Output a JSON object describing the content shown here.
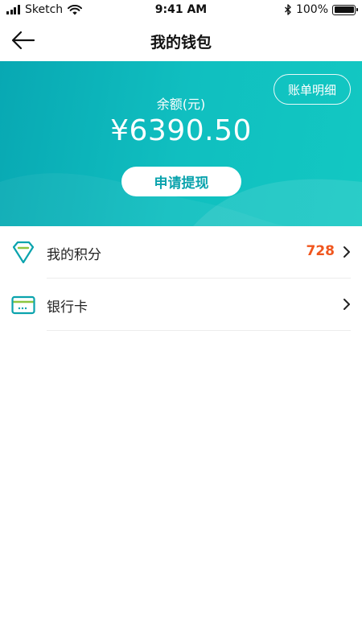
{
  "status_bar": {
    "carrier": "Sketch",
    "time": "9:41 AM",
    "battery": "100%",
    "battery_level": 1.0
  },
  "nav": {
    "title": "我的钱包"
  },
  "balance_card": {
    "statement_label": "账单明细",
    "balance_label": "余额(元)",
    "balance_amount": "¥6390.50",
    "withdraw_label": "申请提现"
  },
  "list": {
    "items": [
      {
        "label": "我的积分",
        "value": "728",
        "icon": "diamond-icon"
      },
      {
        "label": "银行卡",
        "value": "",
        "icon": "bank-card-icon"
      }
    ]
  },
  "colors": {
    "accent_teal": "#0aa3ad",
    "gradient_start": "#08a8b3",
    "gradient_end": "#12c8c2",
    "points_orange": "#f0561e",
    "icon_green": "#8cc63f"
  }
}
